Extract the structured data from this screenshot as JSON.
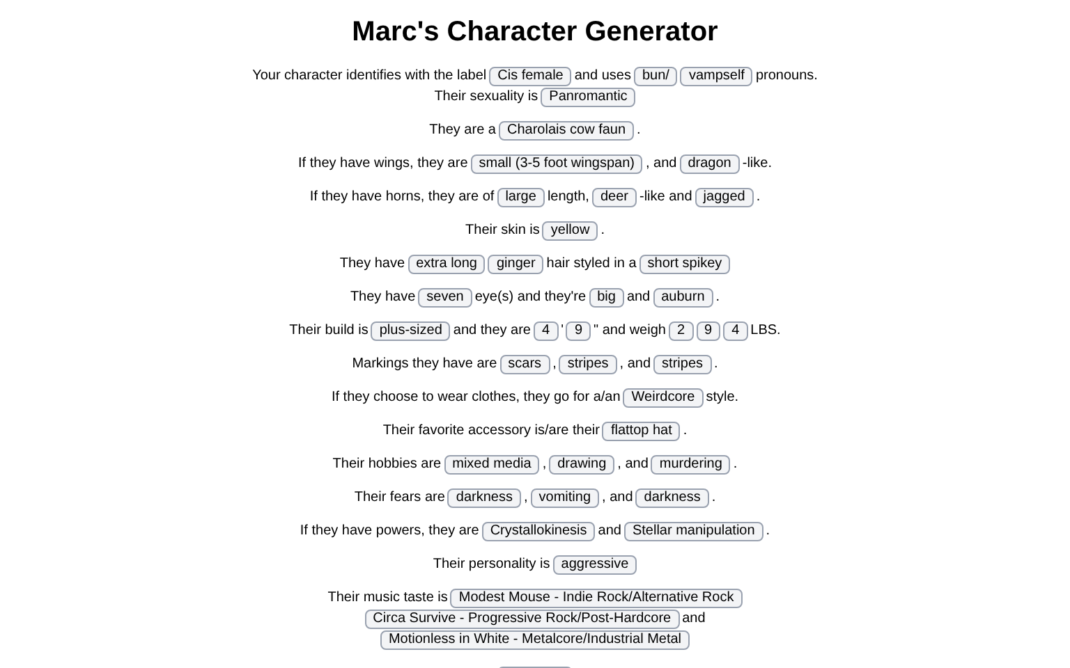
{
  "title": "Marc's Character Generator",
  "paragraphs": [
    [
      {
        "kind": "text",
        "text": "Your character identifies with the label"
      },
      {
        "kind": "button",
        "label": "Cis female"
      },
      {
        "kind": "text",
        "text": "and uses"
      },
      {
        "kind": "button",
        "label": "bun/"
      },
      {
        "kind": "button",
        "label": "vampself"
      },
      {
        "kind": "text",
        "text": "pronouns."
      },
      {
        "kind": "break"
      },
      {
        "kind": "text",
        "text": "Their sexuality is"
      },
      {
        "kind": "button",
        "label": "Panromantic"
      }
    ],
    [
      {
        "kind": "text",
        "text": "They are a"
      },
      {
        "kind": "button",
        "label": "Charolais cow faun"
      },
      {
        "kind": "text",
        "text": "."
      }
    ],
    [
      {
        "kind": "text",
        "text": "If they have wings, they are"
      },
      {
        "kind": "button",
        "label": "small (3-5 foot wingspan)"
      },
      {
        "kind": "text",
        "text": ", and"
      },
      {
        "kind": "button",
        "label": "dragon"
      },
      {
        "kind": "text",
        "text": "-like."
      }
    ],
    [
      {
        "kind": "text",
        "text": "If they have horns, they are of"
      },
      {
        "kind": "button",
        "label": "large"
      },
      {
        "kind": "text",
        "text": "length,"
      },
      {
        "kind": "button",
        "label": "deer"
      },
      {
        "kind": "text",
        "text": "-like and"
      },
      {
        "kind": "button",
        "label": "jagged"
      },
      {
        "kind": "text",
        "text": "."
      }
    ],
    [
      {
        "kind": "text",
        "text": "Their skin is"
      },
      {
        "kind": "button",
        "label": "yellow"
      },
      {
        "kind": "text",
        "text": "."
      }
    ],
    [
      {
        "kind": "text",
        "text": "They have"
      },
      {
        "kind": "button",
        "label": "extra long"
      },
      {
        "kind": "button",
        "label": "ginger"
      },
      {
        "kind": "text",
        "text": "hair styled in a"
      },
      {
        "kind": "button",
        "label": "short spikey"
      }
    ],
    [
      {
        "kind": "text",
        "text": "They have"
      },
      {
        "kind": "button",
        "label": "seven"
      },
      {
        "kind": "text",
        "text": "eye(s) and they're"
      },
      {
        "kind": "button",
        "label": "big"
      },
      {
        "kind": "text",
        "text": "and"
      },
      {
        "kind": "button",
        "label": "auburn"
      },
      {
        "kind": "text",
        "text": "."
      }
    ],
    [
      {
        "kind": "text",
        "text": "Their build is"
      },
      {
        "kind": "button",
        "label": "plus-sized"
      },
      {
        "kind": "text",
        "text": "and they are"
      },
      {
        "kind": "button",
        "label": "4"
      },
      {
        "kind": "text",
        "text": "'"
      },
      {
        "kind": "button",
        "label": "9"
      },
      {
        "kind": "text",
        "text": "\" and weigh"
      },
      {
        "kind": "button",
        "label": "2"
      },
      {
        "kind": "button",
        "label": "9"
      },
      {
        "kind": "button",
        "label": "4"
      },
      {
        "kind": "text",
        "text": "LBS."
      }
    ],
    [
      {
        "kind": "text",
        "text": "Markings they have are"
      },
      {
        "kind": "button",
        "label": "scars"
      },
      {
        "kind": "text",
        "text": ","
      },
      {
        "kind": "button",
        "label": "stripes"
      },
      {
        "kind": "text",
        "text": ", and"
      },
      {
        "kind": "button",
        "label": "stripes"
      },
      {
        "kind": "text",
        "text": "."
      }
    ],
    [
      {
        "kind": "text",
        "text": "If they choose to wear clothes, they go for a/an"
      },
      {
        "kind": "button",
        "label": "Weirdcore"
      },
      {
        "kind": "text",
        "text": "style."
      }
    ],
    [
      {
        "kind": "text",
        "text": "Their favorite accessory is/are their"
      },
      {
        "kind": "button",
        "label": "flattop hat"
      },
      {
        "kind": "text",
        "text": "."
      }
    ],
    [
      {
        "kind": "text",
        "text": "Their hobbies are"
      },
      {
        "kind": "button",
        "label": "mixed media"
      },
      {
        "kind": "text",
        "text": ","
      },
      {
        "kind": "button",
        "label": "drawing"
      },
      {
        "kind": "text",
        "text": ", and"
      },
      {
        "kind": "button",
        "label": "murdering"
      },
      {
        "kind": "text",
        "text": "."
      }
    ],
    [
      {
        "kind": "text",
        "text": "Their fears are"
      },
      {
        "kind": "button",
        "label": "darkness"
      },
      {
        "kind": "text",
        "text": ","
      },
      {
        "kind": "button",
        "label": "vomiting"
      },
      {
        "kind": "text",
        "text": ", and"
      },
      {
        "kind": "button",
        "label": "darkness"
      },
      {
        "kind": "text",
        "text": "."
      }
    ],
    [
      {
        "kind": "text",
        "text": "If they have powers, they are"
      },
      {
        "kind": "button",
        "label": "Crystallokinesis"
      },
      {
        "kind": "text",
        "text": "and"
      },
      {
        "kind": "button",
        "label": "Stellar manipulation"
      },
      {
        "kind": "text",
        "text": "."
      }
    ],
    [
      {
        "kind": "text",
        "text": "Their personality is"
      },
      {
        "kind": "button",
        "label": "aggressive"
      }
    ],
    [
      {
        "kind": "text",
        "text": "Their music taste is"
      },
      {
        "kind": "button",
        "label": "Modest Mouse - Indie Rock/Alternative Rock"
      },
      {
        "kind": "break"
      },
      {
        "kind": "button",
        "label": "Circa Survive - Progressive Rock/Post-Hardcore"
      },
      {
        "kind": "text",
        "text": "and"
      },
      {
        "kind": "break"
      },
      {
        "kind": "button",
        "label": "Motionless in White - Metalcore/Industrial Metal"
      }
    ]
  ]
}
